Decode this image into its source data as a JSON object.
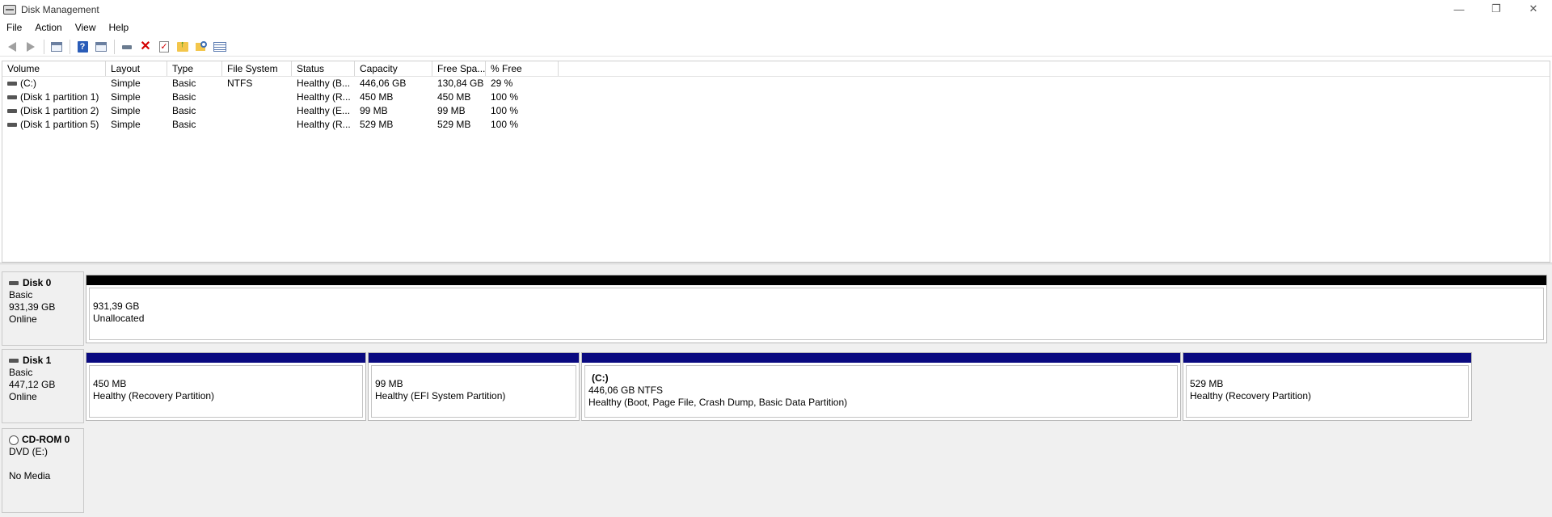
{
  "window": {
    "title": "Disk Management",
    "controls": {
      "minimize": "—",
      "restore": "❐",
      "close": "✕"
    }
  },
  "menu": [
    "File",
    "Action",
    "View",
    "Help"
  ],
  "toolbar": {
    "icons": [
      "back-icon",
      "forward-icon",
      "console-tree-icon",
      "help-icon",
      "properties-icon",
      "connect-icon",
      "delete-icon",
      "check-icon",
      "open-folder-icon",
      "explore-icon",
      "settings-list-icon"
    ]
  },
  "volume_list": {
    "columns": [
      "Volume",
      "Layout",
      "Type",
      "File System",
      "Status",
      "Capacity",
      "Free Spa...",
      "% Free"
    ],
    "rows": [
      [
        "(C:)",
        "Simple",
        "Basic",
        "NTFS",
        "Healthy (B...",
        "446,06 GB",
        "130,84 GB",
        "29 %"
      ],
      [
        "(Disk 1 partition 1)",
        "Simple",
        "Basic",
        "",
        "Healthy (R...",
        "450 MB",
        "450 MB",
        "100 %"
      ],
      [
        "(Disk 1 partition 2)",
        "Simple",
        "Basic",
        "",
        "Healthy (E...",
        "99 MB",
        "99 MB",
        "100 %"
      ],
      [
        "(Disk 1 partition 5)",
        "Simple",
        "Basic",
        "",
        "Healthy (R...",
        "529 MB",
        "529 MB",
        "100 %"
      ]
    ]
  },
  "disks": [
    {
      "name": "Disk 0",
      "type": "Basic",
      "size": "931,39 GB",
      "status": "Online",
      "partitions": [
        {
          "label": "",
          "size": "931,39 GB",
          "status": "Unallocated",
          "bar_color": "#000000"
        }
      ]
    },
    {
      "name": "Disk 1",
      "type": "Basic",
      "size": "447,12 GB",
      "status": "Online",
      "partitions": [
        {
          "label": "",
          "size": "450 MB",
          "status": "Healthy (Recovery Partition)",
          "bar_color": "#0a0a80"
        },
        {
          "label": "",
          "size": "99 MB",
          "status": "Healthy (EFI System Partition)",
          "bar_color": "#0a0a80"
        },
        {
          "label": "(C:)",
          "size": "446,06 GB NTFS",
          "status": "Healthy (Boot, Page File, Crash Dump, Basic Data Partition)",
          "bar_color": "#0a0a80"
        },
        {
          "label": "",
          "size": "529 MB",
          "status": "Healthy (Recovery Partition)",
          "bar_color": "#0a0a80"
        }
      ]
    },
    {
      "name": "CD-ROM 0",
      "type": "DVD (E:)",
      "size": "",
      "status": "No Media",
      "partitions": []
    }
  ]
}
